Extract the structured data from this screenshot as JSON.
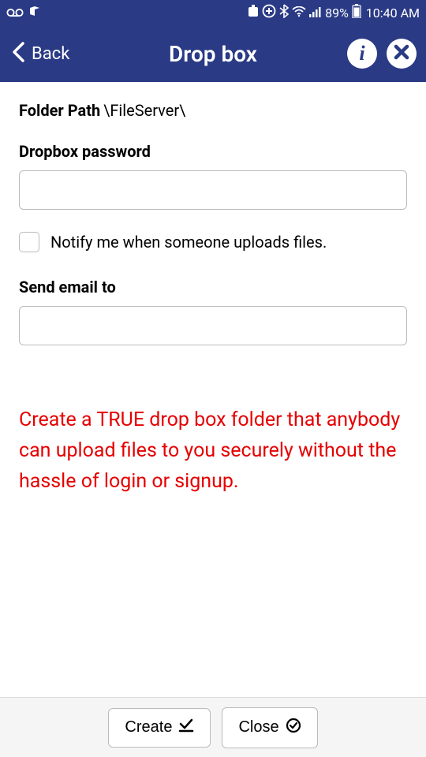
{
  "status": {
    "battery_pct": "89%",
    "time": "10:40 AM"
  },
  "appbar": {
    "back_label": "Back",
    "title": "Drop box"
  },
  "form": {
    "folder_path_label": "Folder Path",
    "folder_path_value": "\\FileServer\\",
    "password_label": "Dropbox password",
    "password_value": "",
    "notify_label": "Notify me when someone uploads files.",
    "send_email_label": "Send email to",
    "send_email_value": ""
  },
  "promo": "Create a TRUE drop box folder that anybody can upload files to you securely without the hassle of login or signup.",
  "footer": {
    "create_label": "Create",
    "close_label": "Close"
  }
}
